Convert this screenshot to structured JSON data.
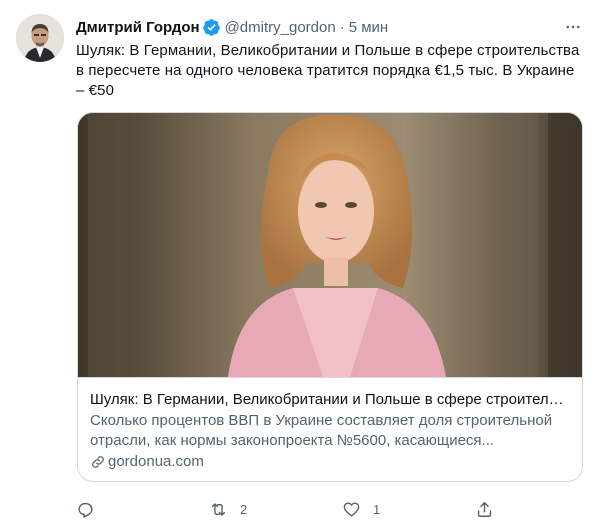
{
  "author": {
    "display_name": "Дмитрий Гордон",
    "handle": "@dmitry_gordon",
    "separator": "·",
    "time": "5 мин"
  },
  "tweet": {
    "text": "Шуляк: В Германии, Великобритании и Польше в сфере строительства в пересчете на одного человека тратится порядка €1,5 тыс. В Украине – €50"
  },
  "card": {
    "title": "Шуляк: В Германии, Великобритании и Польше в сфере строительс...",
    "description": "Сколько процентов ВВП в Украине составляет доля строительной отрасли, как нормы законопроекта №5600, касающиеся...",
    "domain": "gordonua.com"
  },
  "actions": {
    "reply_count": "",
    "retweet_count": "2",
    "like_count": "1",
    "share_count": ""
  },
  "colors": {
    "verified": "#1d9bf0",
    "text_primary": "#0f1419",
    "text_secondary": "#536471",
    "border": "#cfd9de"
  },
  "icons": {
    "verified": "verified-badge-icon",
    "more": "more-options-icon",
    "reply": "reply-icon",
    "retweet": "retweet-icon",
    "like": "heart-icon",
    "share": "share-icon",
    "link": "link-icon"
  }
}
